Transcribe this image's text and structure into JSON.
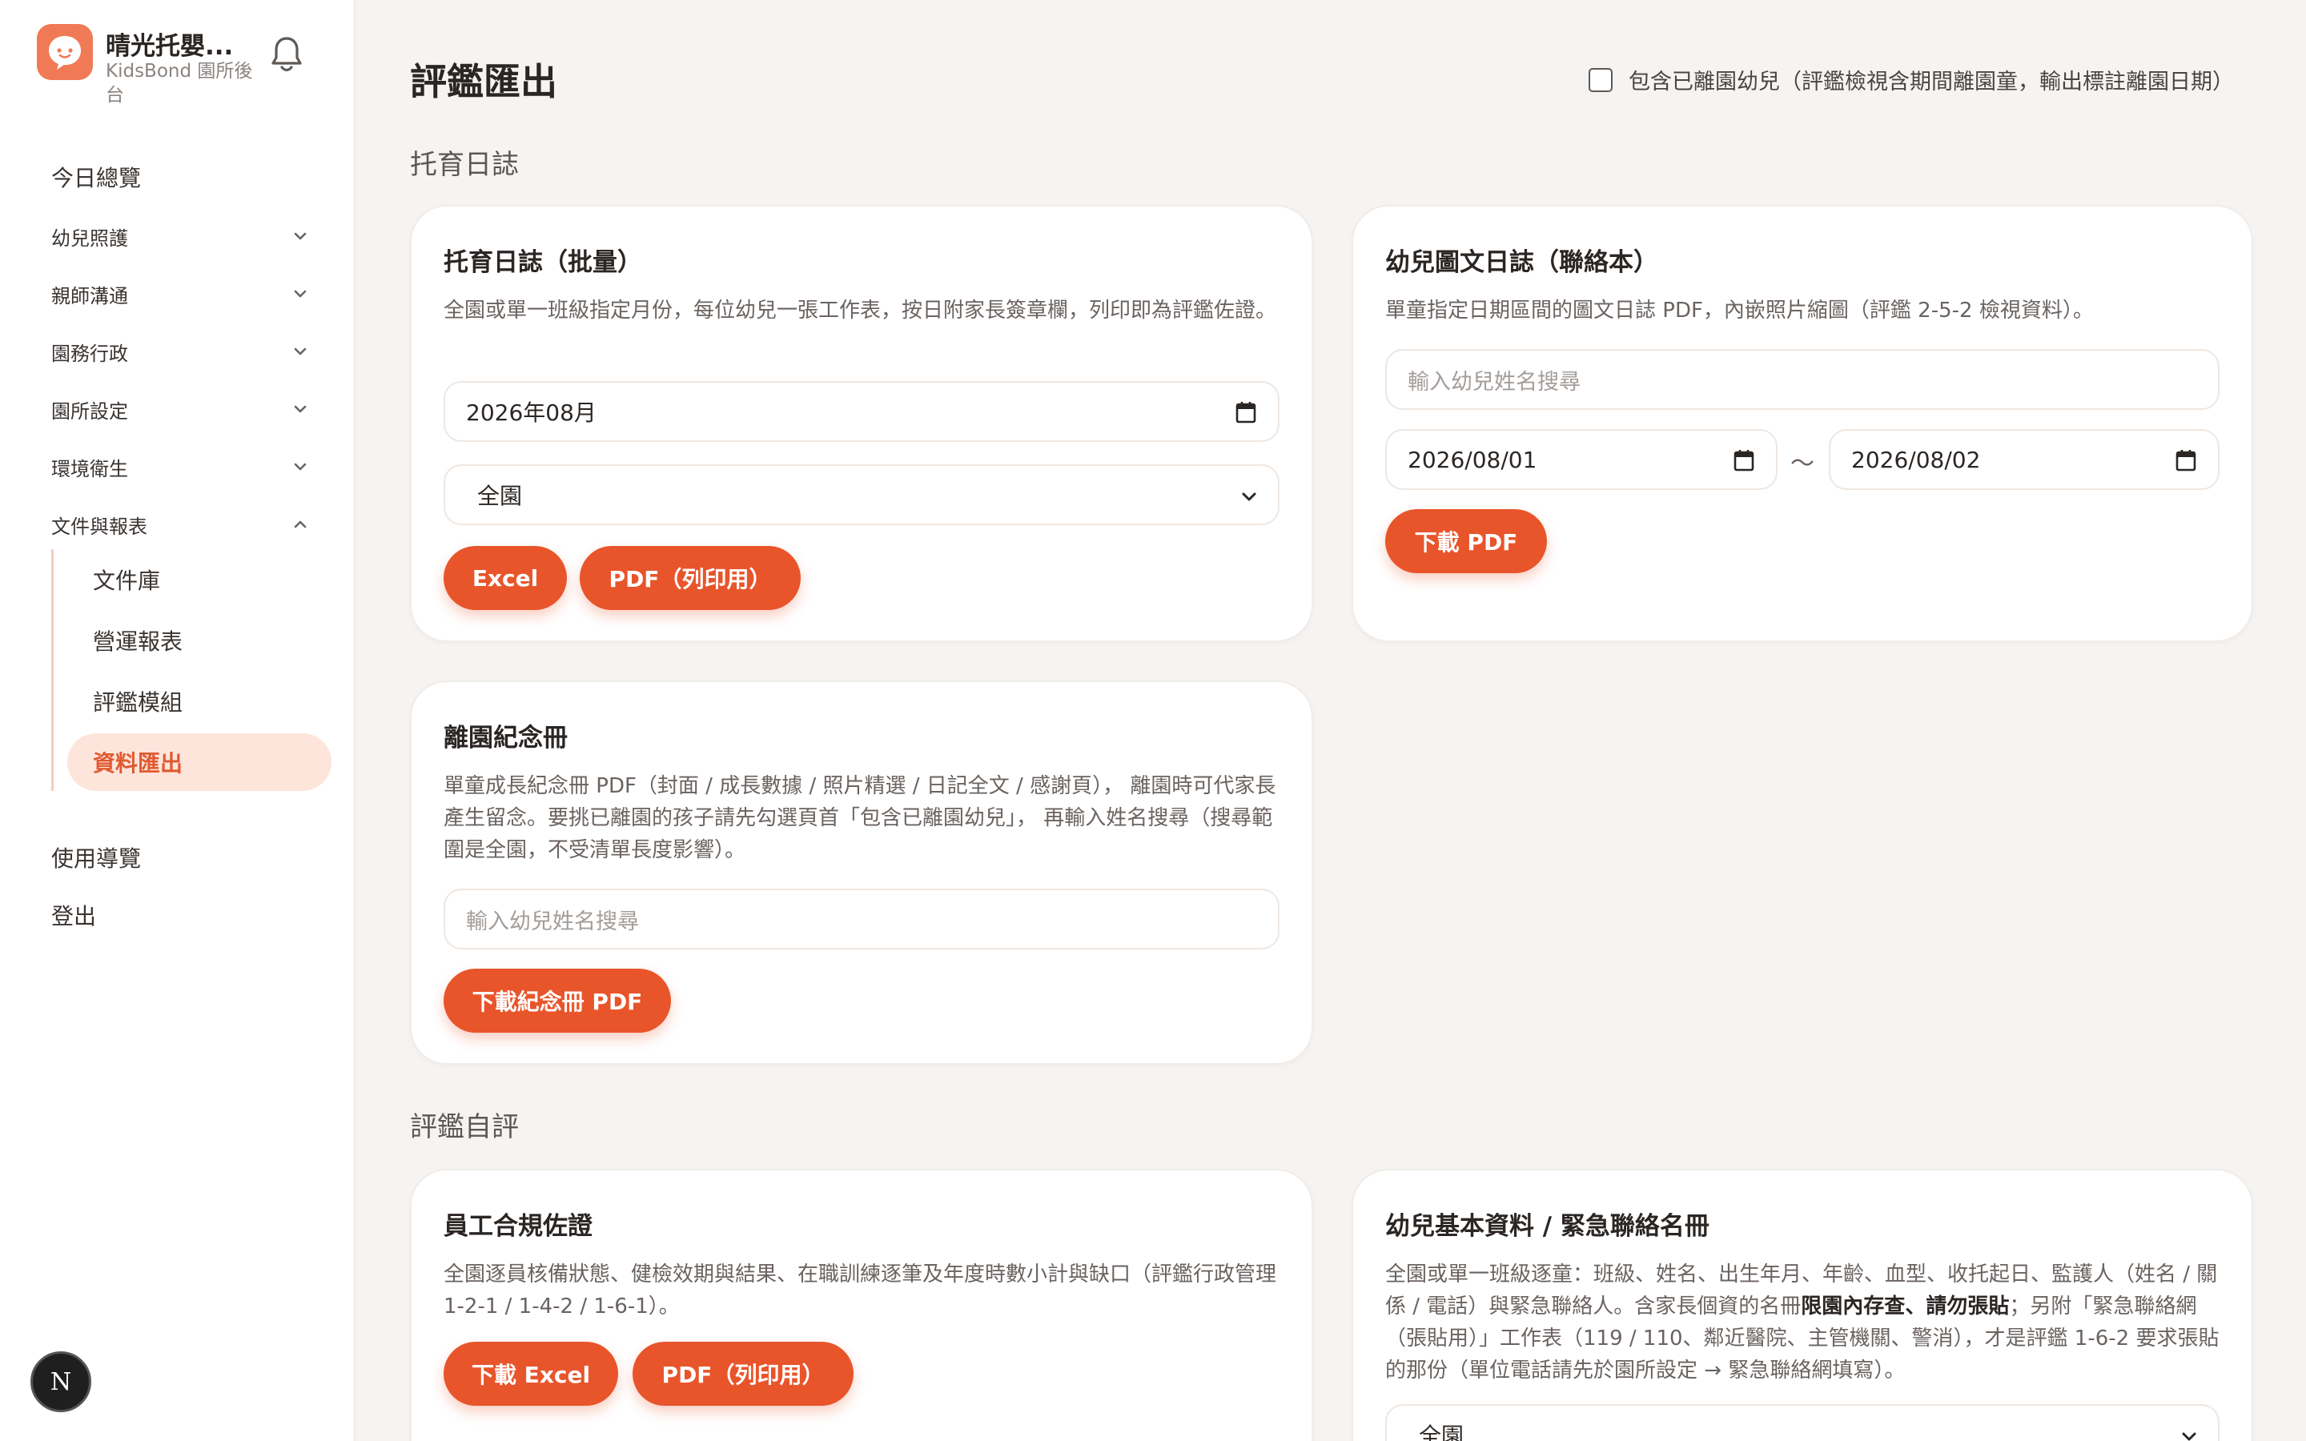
{
  "sidebar": {
    "brand_name": "晴光托嬰...",
    "brand_sub": "KidsBond 園所後台",
    "nav": [
      {
        "label": "今日總覽"
      },
      {
        "label": "幼兒照護"
      },
      {
        "label": "親師溝通"
      },
      {
        "label": "園務行政"
      },
      {
        "label": "園所設定"
      },
      {
        "label": "環境衛生"
      },
      {
        "label": "文件與報表"
      }
    ],
    "sub": [
      {
        "label": "文件庫"
      },
      {
        "label": "營運報表"
      },
      {
        "label": "評鑑模組"
      },
      {
        "label": "資料匯出"
      }
    ],
    "guide": "使用導覽",
    "logout": "登出",
    "badge": "N"
  },
  "header": {
    "title": "評鑑匯出",
    "include_label": "包含已離園幼兒（評鑑檢視含期間離園童，輸出標註離園日期）"
  },
  "sections": {
    "diary": "托育日誌",
    "selfeval": "評鑑自評"
  },
  "cards": {
    "batch": {
      "title": "托育日誌（批量）",
      "desc": "全園或單一班級指定月份，每位幼兒一張工作表，按日附家長簽章欄，列印即為評鑑佐證。",
      "month": "2026年08月",
      "scope": "全園",
      "btn_excel": "Excel",
      "btn_pdf": "PDF（列印用）"
    },
    "picdiary": {
      "title": "幼兒圖文日誌（聯絡本）",
      "desc": "單童指定日期區間的圖文日誌 PDF，內嵌照片縮圖（評鑑 2-5-2 檢視資料）。",
      "search_placeholder": "輸入幼兒姓名搜尋",
      "date_from": "2026/08/01",
      "tilde": "～",
      "date_to": "2026/08/02",
      "btn": "下載 PDF"
    },
    "memorial": {
      "title": "離園紀念冊",
      "desc": "單童成長紀念冊 PDF（封面 / 成長數據 / 照片精選 / 日記全文 / 感謝頁）， 離園時可代家長產生留念。要挑已離園的孩子請先勾選頁首「包含已離園幼兒」， 再輸入姓名搜尋（搜尋範圍是全園，不受清單長度影響）。",
      "search_placeholder": "輸入幼兒姓名搜尋",
      "btn": "下載紀念冊 PDF"
    },
    "staff": {
      "title": "員工合規佐證",
      "desc": "全園逐員核備狀態、健檢效期與結果、在職訓練逐筆及年度時數小計與缺口（評鑑行政管理 1-2-1 / 1-4-2 / 1-6-1）。",
      "btn_excel": "下載 Excel",
      "btn_pdf": "PDF（列印用）"
    },
    "roster": {
      "title": "幼兒基本資料 / 緊急聯絡名冊",
      "desc_1": "全園或單一班級逐童：班級、姓名、出生年月、年齡、血型、收托起日、監護人（姓名 / 關係 / 電話）與緊急聯絡人。含家長個資的名冊",
      "desc_bold_1": "限園內存查",
      "desc_2": "、",
      "desc_bold_2": "請勿張貼",
      "desc_3": "；另附「緊急聯絡網（張貼用）」工作表（119 / 110、鄰近醫院、主管機關、警消），才是評鑑 1-6-2 要求張貼的那份（單位電話請先於園所設定 → 緊急聯絡網填寫）。",
      "scope": "全園"
    }
  },
  "colors": {
    "accent": "#e8552b",
    "active_bg": "#fde5db",
    "background": "#f6f4f2"
  }
}
